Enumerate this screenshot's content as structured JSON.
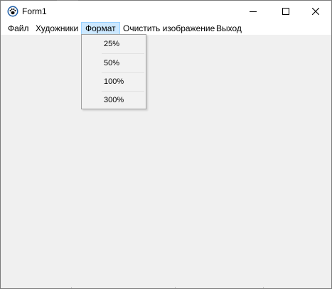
{
  "window": {
    "title": "Form1",
    "app_icon": "paw-icon",
    "caption_buttons": [
      "minimize-icon",
      "maximize-icon",
      "close-icon"
    ]
  },
  "menubar": {
    "items": [
      {
        "label": "Файл"
      },
      {
        "label": "Художники"
      },
      {
        "label": "Формат",
        "active": true
      },
      {
        "label": "Очистить изображение"
      },
      {
        "label": "Выход"
      }
    ]
  },
  "format_menu": {
    "items": [
      {
        "label": "25%"
      },
      {
        "label": "50%"
      },
      {
        "label": "100%"
      },
      {
        "label": "300%"
      }
    ]
  },
  "colors": {
    "menu_highlight": "#cce8ff",
    "menu_highlight_border": "#99d1ff",
    "client_background": "#f0f0f0"
  }
}
